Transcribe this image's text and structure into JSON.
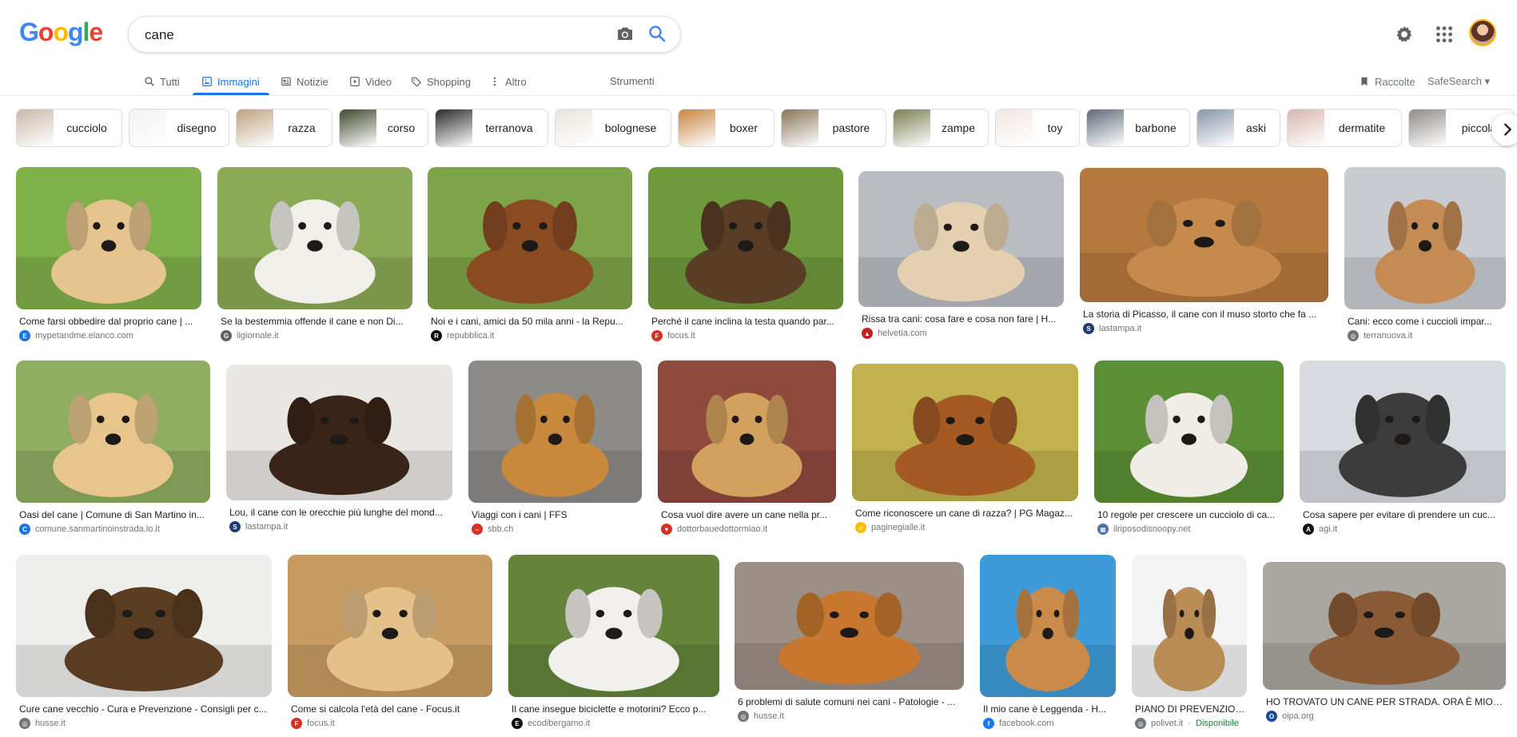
{
  "header": {
    "logo": {
      "b1": "G",
      "r1": "o",
      "y1": "o",
      "b2": "g",
      "g1": "l",
      "r2": "e"
    },
    "search": {
      "value": "cane",
      "placeholder": ""
    }
  },
  "tabs": {
    "all": "Tutti",
    "images": "Immagini",
    "news": "Notizie",
    "video": "Video",
    "shopping": "Shopping",
    "more": "Altro",
    "tools": "Strumenti",
    "collections": "Raccolte",
    "safesearch": "SafeSearch ▾"
  },
  "colors": {
    "accent": "#1a73e8",
    "green": "#188038"
  },
  "chips": [
    {
      "label": "cucciolo",
      "color": "#c9b9a7"
    },
    {
      "label": "disegno",
      "color": "#f2f2f2"
    },
    {
      "label": "razza",
      "color": "#bda381"
    },
    {
      "label": "corso",
      "color": "#3d4a2c"
    },
    {
      "label": "terranova",
      "color": "#2a2a2a"
    },
    {
      "label": "bolognese",
      "color": "#e9e4da"
    },
    {
      "label": "boxer",
      "color": "#c98642"
    },
    {
      "label": "pastore",
      "color": "#8a7559"
    },
    {
      "label": "zampe",
      "color": "#7a7f54"
    },
    {
      "label": "toy",
      "color": "#f2e7e2"
    },
    {
      "label": "barbone",
      "color": "#5f6b77"
    },
    {
      "label": "aski",
      "color": "#8896a8"
    },
    {
      "label": "dermatite",
      "color": "#d8b6b0"
    },
    {
      "label": "piccola",
      "color": "#8f8b86"
    }
  ],
  "results": [
    {
      "title": "Come farsi obbedire dal proprio cane | ...",
      "source": "mypetandme.elanco.com",
      "bg": "#7fb04a",
      "dog": "#e6c48f",
      "fav": "#1a73e8",
      "fav_text": "E"
    },
    {
      "title": "Se la bestemmia offende il cane e non Di...",
      "source": "ilgiornale.it",
      "bg": "#8aaa56",
      "dog": "#f1efe9",
      "fav": "#5f6368",
      "fav_text": "G"
    },
    {
      "title": "Noi e i cani, amici da 50 mila anni - la Repu...",
      "source": "repubblica.it",
      "bg": "#7ea44a",
      "dog": "#8a4a22",
      "fav": "#111111",
      "fav_text": "R"
    },
    {
      "title": "Perché il cane inclina la testa quando par...",
      "source": "focus.it",
      "bg": "#6f9a3c",
      "dog": "#5a3d25",
      "fav": "#d93025",
      "fav_text": "F"
    },
    {
      "title": "Rissa tra cani: cosa fare e cosa non fare | H...",
      "source": "helvetia.com",
      "bg": "#b9bcc0",
      "dog": "#e5cfb1",
      "fav": "#c5221f",
      "fav_text": "▲"
    },
    {
      "title": "La storia di Picasso, il cane con il muso storto che fa ...",
      "source": "lastampa.it",
      "bg": "#b5793e",
      "dog": "#c68a4c",
      "fav": "#1f3b70",
      "fav_text": "S"
    },
    {
      "title": "Cani: ecco come i cuccioli impar...",
      "source": "terranuova.it",
      "bg": "#c8ccd1",
      "dog": "#c48b55",
      "fav": "#70757a",
      "fav_text": "◎"
    },
    {
      "title": "Oasi del cane | Comune di San Martino in...",
      "source": "comune.sanmartinoinstrada.lo.it",
      "bg": "#8fae62",
      "dog": "#e7c58d",
      "fav": "#1a73e8",
      "fav_text": "C"
    },
    {
      "title": "Lou, il cane con le orecchie più lunghe del mond...",
      "source": "lastampa.it",
      "bg": "#e9e7e4",
      "dog": "#3a2418",
      "fav": "#1f3b70",
      "fav_text": "S"
    },
    {
      "title": "Viaggi con i cani | FFS",
      "source": "sbb.ch",
      "bg": "#8d8b88",
      "dog": "#c9893d",
      "fav": "#d93025",
      "fav_text": "⇔"
    },
    {
      "title": "Cosa vuol dire avere un cane nella pr...",
      "source": "dottorbauedottormiao.it",
      "bg": "#8f4a3e",
      "dog": "#d3a15e",
      "fav": "#d93025",
      "fav_text": "♥"
    },
    {
      "title": "Come riconoscere un cane di razza? | PG Magaz...",
      "source": "paginegialle.it",
      "bg": "#c1b24f",
      "dog": "#a55a24",
      "fav": "#fbbc05",
      "fav_text": "☺"
    },
    {
      "title": "10 regole per crescere un cucciolo di ca...",
      "source": "ilriposodisnoopy.net",
      "bg": "#5c8f35",
      "dog": "#f0ece6",
      "fav": "#4a6fa5",
      "fav_text": "▦"
    },
    {
      "title": "Cosa sapere per evitare di prendere un cuc...",
      "source": "agi.it",
      "bg": "#d7dbe0",
      "dog": "#3c3c3c",
      "fav": "#111111",
      "fav_text": "A"
    },
    {
      "title": "Cure cane vecchio - Cura e Prevenzione - Consigli per c...",
      "source": "husse.it",
      "bg": "#eeeeec",
      "dog": "#5a3c22",
      "fav": "#70757a",
      "fav_text": "◎"
    },
    {
      "title": "Come si calcola l'età del cane - Focus.it",
      "source": "focus.it",
      "bg": "#c89b62",
      "dog": "#e4c08a",
      "fav": "#d93025",
      "fav_text": "F"
    },
    {
      "title": "Il cane insegue biciclette e motorini? Ecco p...",
      "source": "ecodibergamo.it",
      "bg": "#63843a",
      "dog": "#f2f0ec",
      "fav": "#111111",
      "fav_text": "E"
    },
    {
      "title": "6 problemi di salute comuni nei cani - Patologie - ...",
      "source": "husse.it",
      "bg": "#9c8f86",
      "dog": "#c7782e",
      "fav": "#70757a",
      "fav_text": "◎"
    },
    {
      "title": "Il mio cane è Leggenda - H...",
      "source": "facebook.com",
      "bg": "#3f9bd8",
      "dog": "#c98a4a",
      "fav": "#1877f2",
      "fav_text": "f"
    },
    {
      "title": "PIANO DI PREVENZION...",
      "source": "polivet.it",
      "avail": "Disponibile",
      "bg": "#f3f3f3",
      "dog": "#b98b55",
      "fav": "#70757a",
      "fav_text": "◎"
    },
    {
      "title": "HO TROVATO UN CANE PER STRADA. ORA È MIO? |...",
      "source": "oipa.org",
      "bg": "#aaa7a1",
      "dog": "#8a5a36",
      "fav": "#1a4a9a",
      "fav_text": "O"
    }
  ]
}
